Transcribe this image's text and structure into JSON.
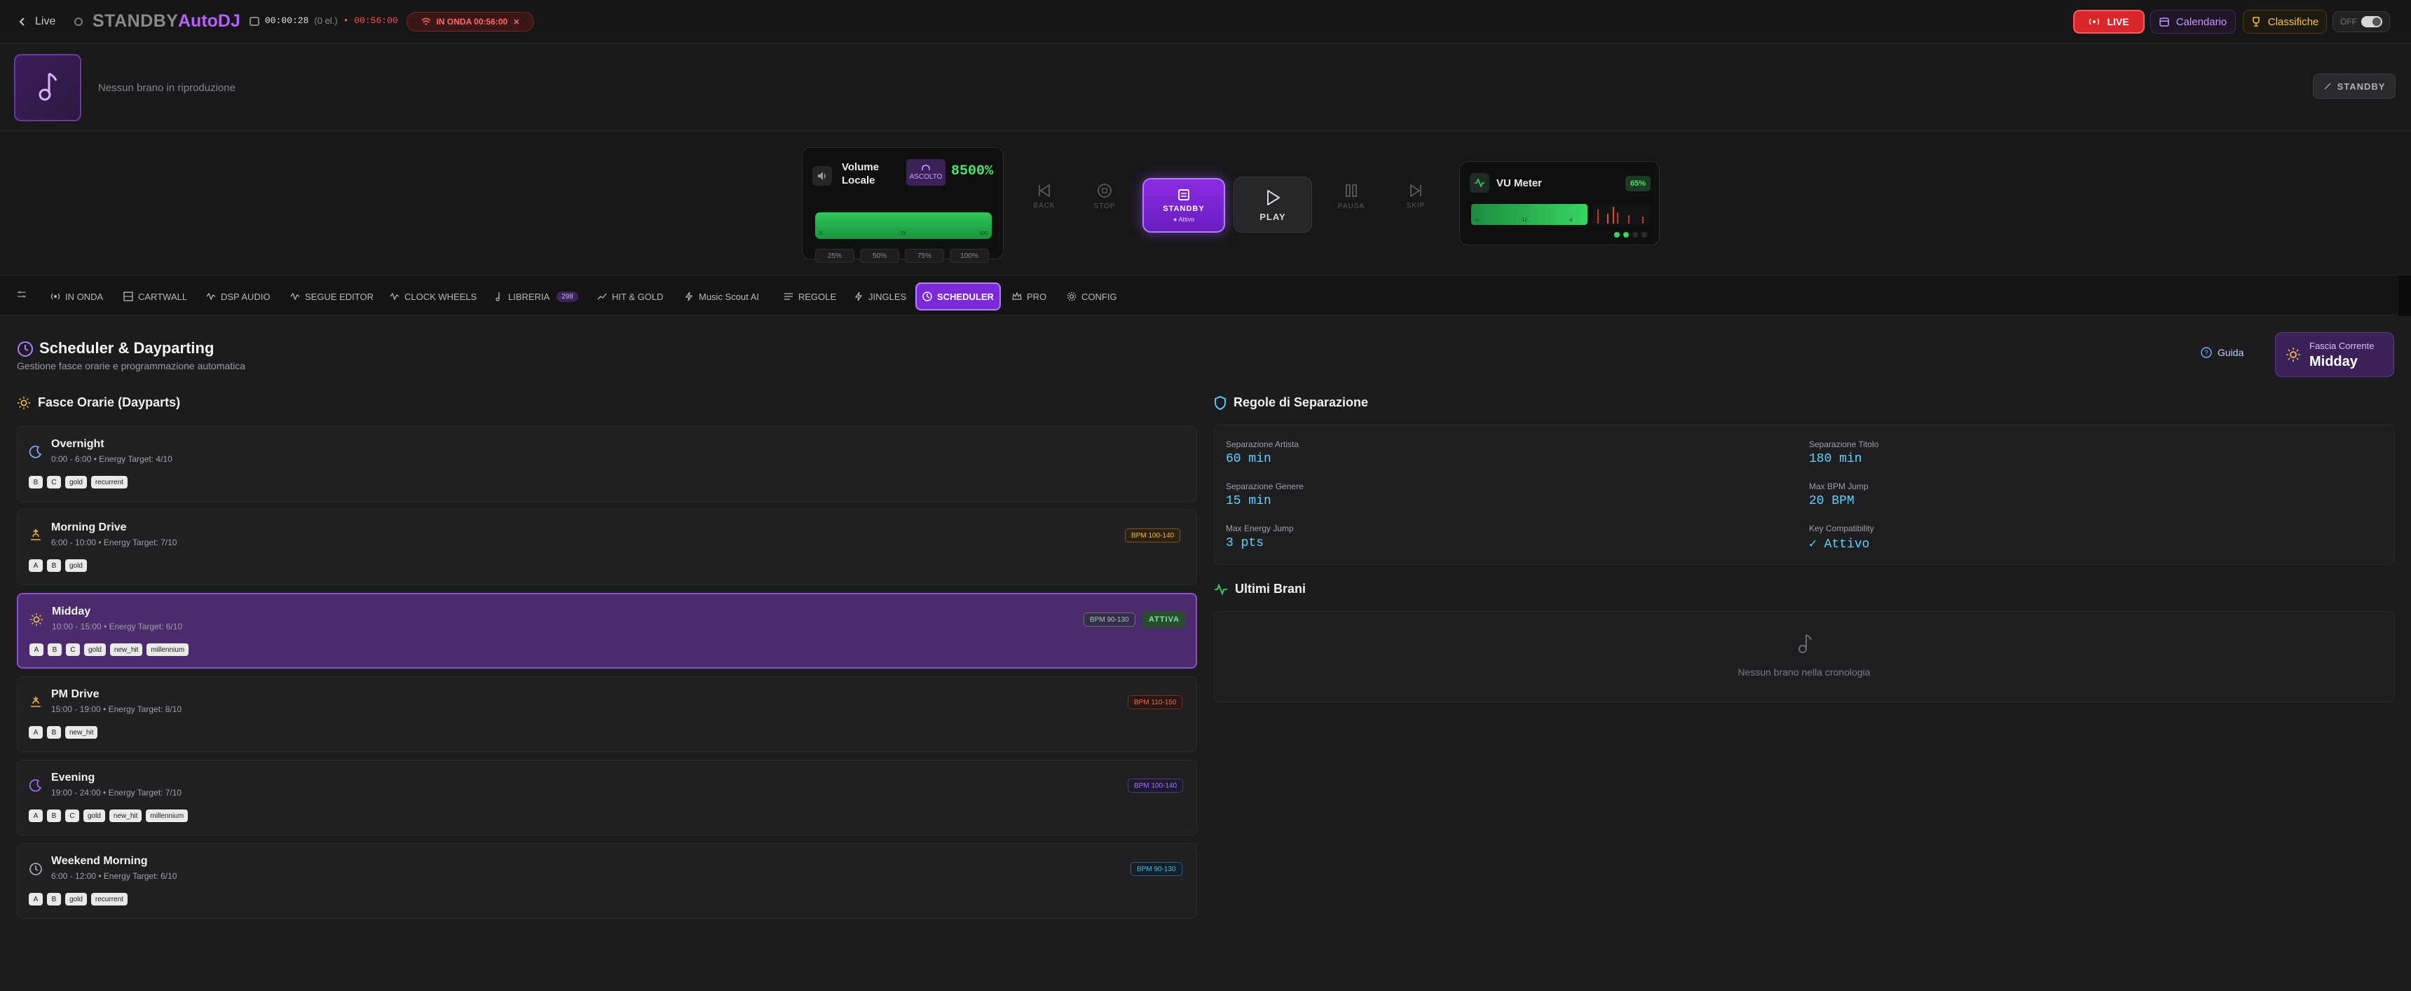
{
  "topbar": {
    "back_label": "Live",
    "brand_standby": "STANDBY",
    "brand_autodj": "AutoDJ",
    "elapsed": "00:00:28",
    "queue_count": "(0 el.)",
    "remaining": "• 00:56:00",
    "onair_label": "IN ONDA 00:56:00",
    "live_label": "LIVE",
    "calendar_label": "Calendario",
    "charts_label": "Classifiche",
    "toggle_label": "OFF"
  },
  "now_playing": {
    "text": "Nessun brano in riproduzione",
    "mode_chip": "STANDBY"
  },
  "deck": {
    "volume": {
      "title_line1": "Volume",
      "title_line2": "Locale",
      "listen_label": "ASCOLTO",
      "value_label": "8500%",
      "presets": [
        "25%",
        "50%",
        "75%",
        "100%"
      ]
    },
    "transport": {
      "back": "BACK",
      "stop": "STOP",
      "standby": "STANDBY",
      "standby_sub": "● Attivo",
      "play": "PLAY",
      "pause": "PAUSA",
      "skip": "SKIP"
    },
    "vu": {
      "title": "VU Meter",
      "percent_label": "65%",
      "level": 0.65
    }
  },
  "nav": {
    "items": [
      {
        "label": "IN ONDA"
      },
      {
        "label": "CARTWALL"
      },
      {
        "label": "DSP AUDIO"
      },
      {
        "label": "SEGUE EDITOR"
      },
      {
        "label": "CLOCK WHEELS"
      },
      {
        "label": "LIBRERIA",
        "badge": "298"
      },
      {
        "label": "HIT & GOLD"
      },
      {
        "label": "Music Scout AI"
      },
      {
        "label": "REGOLE"
      },
      {
        "label": "JINGLES"
      },
      {
        "label": "SCHEDULER",
        "active": true
      },
      {
        "label": "PRO"
      },
      {
        "label": "CONFIG"
      }
    ]
  },
  "page": {
    "title": "Scheduler & Dayparting",
    "subtitle": "Gestione fasce orarie e programmazione automatica",
    "guide_label": "Guida",
    "current_label": "Fascia Corrente",
    "current_value": "Midday"
  },
  "dayparts": {
    "title": "Fasce Orarie (Dayparts)",
    "items": [
      {
        "name": "Overnight",
        "meta": "0:00 - 6:00 • Energy Target: 4/10",
        "tags": [
          "B",
          "C",
          "gold",
          "recurrent"
        ],
        "bpm": "",
        "icon": "moon-icon"
      },
      {
        "name": "Morning Drive",
        "meta": "6:00 - 10:00 • Energy Target: 7/10",
        "tags": [
          "A",
          "B",
          "gold"
        ],
        "bpm": "BPM 100-140",
        "bpm_color": "#f5b43a",
        "icon": "sunrise-icon"
      },
      {
        "name": "Midday",
        "meta": "10:00 - 15:00 • Energy Target: 6/10",
        "tags": [
          "A",
          "B",
          "C",
          "gold",
          "new_hit",
          "millennium"
        ],
        "bpm": "BPM 90-130",
        "bpm_color": "#8bd3a0",
        "active": true,
        "active_label": "ATTIVA",
        "icon": "sun-icon"
      },
      {
        "name": "PM Drive",
        "meta": "15:00 - 19:00 • Energy Target: 8/10",
        "tags": [
          "A",
          "B",
          "new_hit"
        ],
        "bpm": "BPM 110-150",
        "bpm_color": "#f06a4a",
        "icon": "sunset-icon"
      },
      {
        "name": "Evening",
        "meta": "19:00 - 24:00 • Energy Target: 7/10",
        "tags": [
          "A",
          "B",
          "C",
          "gold",
          "new_hit",
          "millennium"
        ],
        "bpm": "BPM 100-140",
        "bpm_color": "#a872ff",
        "icon": "moon-icon"
      },
      {
        "name": "Weekend Morning",
        "meta": "6:00 - 12:00 • Energy Target: 6/10",
        "tags": [
          "A",
          "B",
          "gold",
          "recurrent"
        ],
        "bpm": "BPM 90-130",
        "bpm_color": "#49b8e8",
        "icon": "clock-icon"
      }
    ]
  },
  "separation": {
    "title": "Regole di Separazione",
    "rules": [
      {
        "label": "Separazione Artista",
        "value": "60 min"
      },
      {
        "label": "Separazione Titolo",
        "value": "180 min"
      },
      {
        "label": "Separazione Genere",
        "value": "15 min"
      },
      {
        "label": "Max BPM Jump",
        "value": "20 BPM"
      },
      {
        "label": "Max Energy Jump",
        "value": "3 pts"
      },
      {
        "label": "Key Compatibility",
        "value": "✓ Attivo"
      }
    ]
  },
  "history": {
    "title": "Ultimi Brani",
    "empty_text": "Nessun brano nella cronologia"
  },
  "colors": {
    "accent": "#8a2be2",
    "live": "#d9262b",
    "green": "#3ad460",
    "cyan": "#5fd1ff"
  }
}
